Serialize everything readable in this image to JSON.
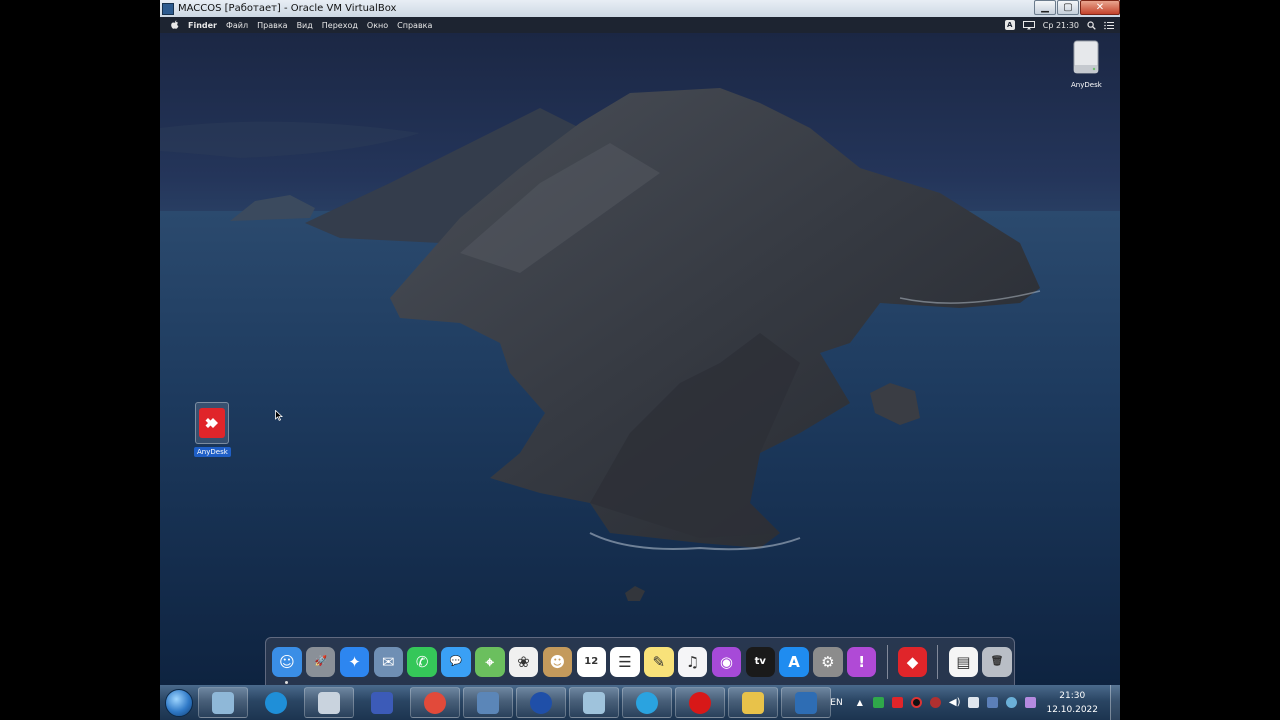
{
  "vbox": {
    "title": "MACCOS [Работает] - Oracle VM VirtualBox",
    "minimize": "▁",
    "restore": "▢",
    "close": "✕"
  },
  "menubar": {
    "apple_icon": "apple-icon",
    "items": [
      "Finder",
      "Файл",
      "Правка",
      "Вид",
      "Переход",
      "Окно",
      "Справка"
    ],
    "keyboard_badge": "A",
    "clock": "Ср 21:30"
  },
  "desktop": {
    "drive_label": "AnyDesk",
    "anydesk_label": "AnyDesk"
  },
  "dock": {
    "apps": [
      {
        "name": "finder",
        "icon": "finder-icon",
        "color": "#3a8ee6",
        "glyph": "☺"
      },
      {
        "name": "launchpad",
        "icon": "rocket-icon",
        "color": "#8a9098",
        "glyph": "🚀"
      },
      {
        "name": "safari",
        "icon": "compass-icon",
        "color": "#2d86f0",
        "glyph": "✦"
      },
      {
        "name": "mail",
        "icon": "eagle-stamp-icon",
        "color": "#6f8fb4",
        "glyph": "✉"
      },
      {
        "name": "facetime",
        "icon": "video-call-icon",
        "color": "#35c759",
        "glyph": "✆"
      },
      {
        "name": "messages",
        "icon": "message-bubble-icon",
        "color": "#3aa0f5",
        "glyph": "💬"
      },
      {
        "name": "maps",
        "icon": "map-icon",
        "color": "#6bbf5e",
        "glyph": "⌖"
      },
      {
        "name": "photos",
        "icon": "flower-icon",
        "color": "#f0f0f0",
        "glyph": "❀"
      },
      {
        "name": "contacts",
        "icon": "address-book-icon",
        "color": "#c49a5c",
        "glyph": "☻"
      },
      {
        "name": "calendar",
        "icon": "calendar-icon",
        "color": "#ffffff",
        "glyph": "12"
      },
      {
        "name": "reminders",
        "icon": "checklist-icon",
        "color": "#ffffff",
        "glyph": "☰"
      },
      {
        "name": "notes",
        "icon": "notepad-icon",
        "color": "#f8e27a",
        "glyph": "✎"
      },
      {
        "name": "music",
        "icon": "music-note-icon",
        "color": "#f5f5f7",
        "glyph": "♫"
      },
      {
        "name": "podcasts",
        "icon": "podcast-icon",
        "color": "#a64ad8",
        "glyph": "◉"
      },
      {
        "name": "tv",
        "icon": "apple-tv-icon",
        "color": "#1a1a1a",
        "glyph": "tv"
      },
      {
        "name": "app-store",
        "icon": "app-store-icon",
        "color": "#1f8cf0",
        "glyph": "A"
      },
      {
        "name": "system-preferences",
        "icon": "gear-icon",
        "color": "#8c8c8c",
        "glyph": "⚙"
      },
      {
        "name": "feedback",
        "icon": "feedback-icon",
        "color": "#b04ad6",
        "glyph": "!"
      }
    ],
    "extra": [
      {
        "name": "anydesk",
        "icon": "anydesk-icon",
        "color": "#e0252a",
        "glyph": "◆"
      },
      {
        "name": "downloads",
        "icon": "document-icon",
        "color": "#f5f5f5",
        "glyph": "▤"
      },
      {
        "name": "trash",
        "icon": "trash-icon",
        "color": "#b9bec6",
        "glyph": "🗑"
      }
    ]
  },
  "taskbar": {
    "buttons": [
      {
        "name": "window-switcher",
        "icon": "switcher-icon",
        "color": "#8fb8d8"
      },
      {
        "name": "edge",
        "icon": "edge-icon",
        "color": "#1f8fd8"
      },
      {
        "name": "calculator",
        "icon": "calculator-icon",
        "color": "#c9d3de"
      },
      {
        "name": "floppy-app",
        "icon": "floppy-disk-icon",
        "color": "#3c5bb8"
      },
      {
        "name": "chrome",
        "icon": "chrome-icon",
        "color": "#e24a3a"
      },
      {
        "name": "app-7",
        "icon": "app-7-icon",
        "color": "#5b86b8"
      },
      {
        "name": "network-app",
        "icon": "globe-icon",
        "color": "#1f4fa8"
      },
      {
        "name": "window-app",
        "icon": "window-icon",
        "color": "#9fc3dc"
      },
      {
        "name": "telegram",
        "icon": "telegram-icon",
        "color": "#2aa3e0"
      },
      {
        "name": "recorder",
        "icon": "record-icon",
        "color": "#d81818"
      },
      {
        "name": "explorer",
        "icon": "folder-icon",
        "color": "#e8c24a"
      },
      {
        "name": "virtualbox",
        "icon": "virtualbox-icon",
        "color": "#2e6db4"
      }
    ],
    "language": "EN",
    "time": "21:30",
    "date": "12.10.2022"
  }
}
